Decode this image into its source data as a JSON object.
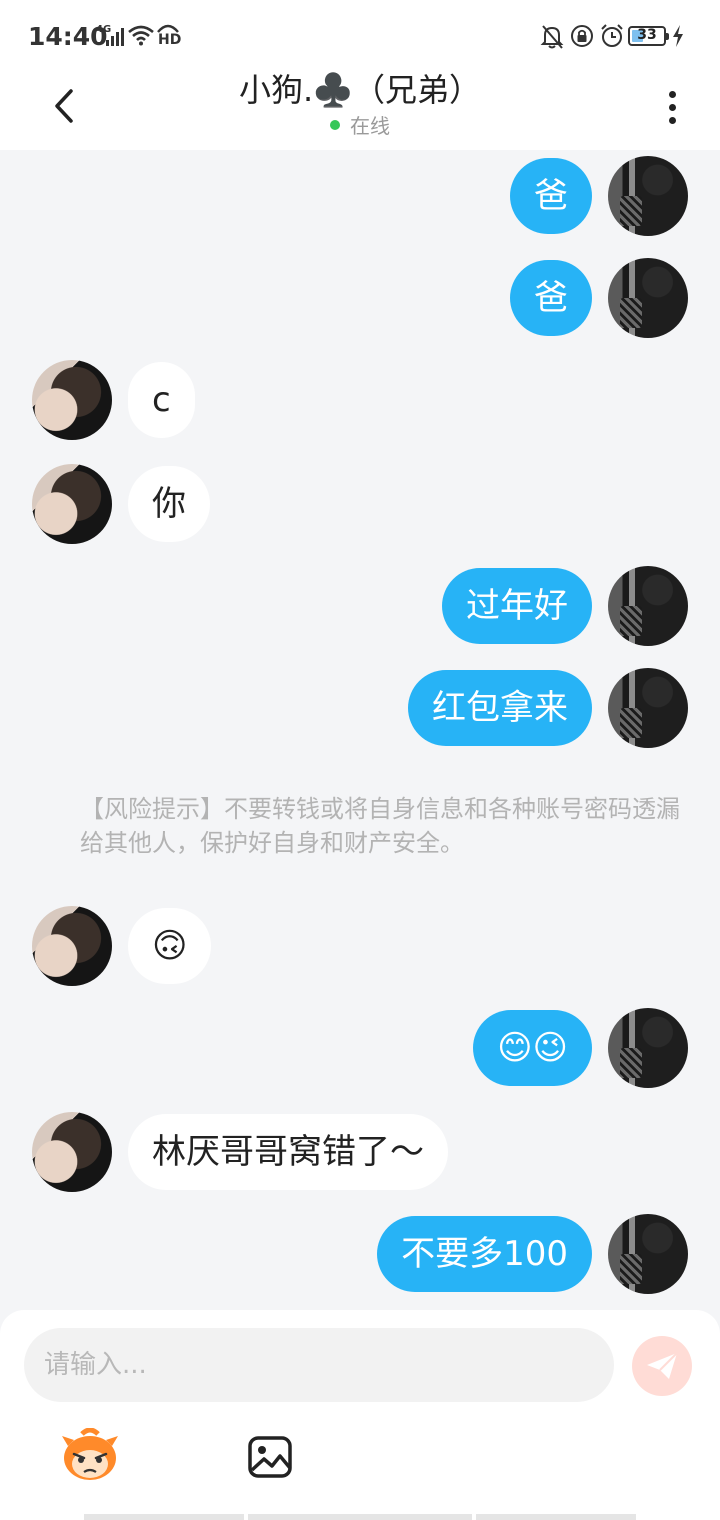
{
  "status_bar": {
    "time": "14:40",
    "network": "4G",
    "hd": "HD",
    "battery_level": "33",
    "icons": [
      "signal-icon",
      "wifi-icon",
      "hd-icon",
      "bell-off-icon",
      "lock-icon",
      "alarm-icon",
      "battery-icon",
      "charging-icon"
    ]
  },
  "header": {
    "title": "小狗.♣️（兄弟）",
    "status": "在线",
    "status_color": "#35c759",
    "icons": [
      "back-arrow-icon",
      "more-icon"
    ]
  },
  "messages": [
    {
      "side": "me",
      "text": "爸"
    },
    {
      "side": "me",
      "text": "爸"
    },
    {
      "side": "other",
      "text": "c"
    },
    {
      "side": "other",
      "text": "你"
    },
    {
      "side": "me",
      "text": "过年好"
    },
    {
      "side": "me",
      "text": "红包拿来"
    },
    {
      "side": "other",
      "text": "🙃"
    },
    {
      "side": "me",
      "text": "😊😉"
    },
    {
      "side": "other",
      "text": "林厌哥哥窝错了～"
    },
    {
      "side": "me",
      "text": "不要多100"
    }
  ],
  "risk_notice": "【风险提示】不要转钱或将自身信息和各种账号密码透漏给其他人，保护好自身和财产安全。",
  "input": {
    "placeholder": "请输入...",
    "value": ""
  },
  "toolbar": {
    "icons": [
      "mascot-sticker-icon",
      "image-picker-icon",
      "send-icon"
    ]
  },
  "colors": {
    "my_bubble": "#27b3f6",
    "other_bubble": "#ffffff",
    "background": "#f4f5f7",
    "send_button": "#ffdcd6"
  }
}
